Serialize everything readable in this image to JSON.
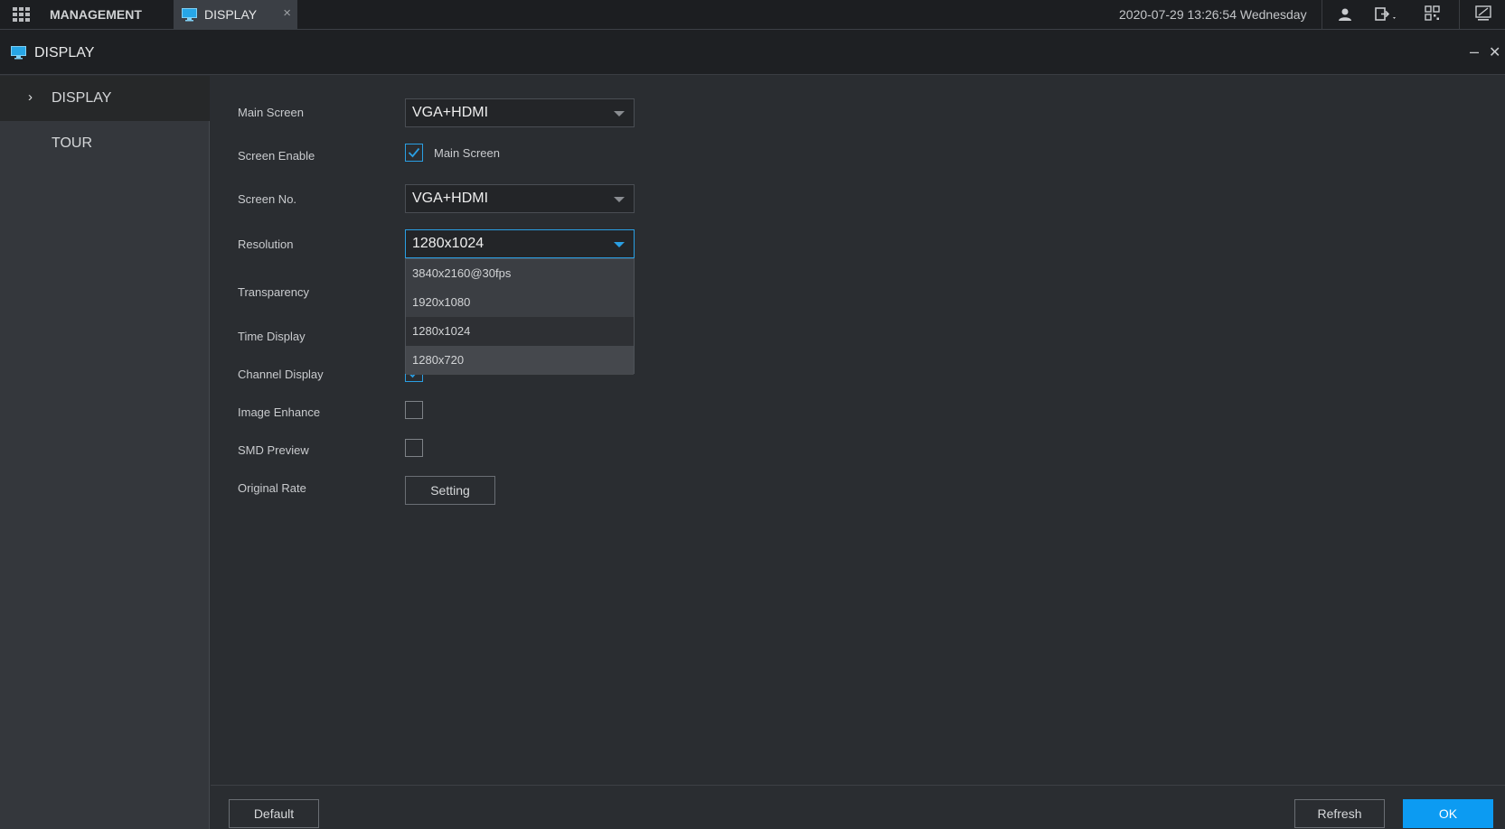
{
  "topbar": {
    "management_label": "MANAGEMENT",
    "tab_label": "DISPLAY",
    "tab_close": "×",
    "datetime": "2020-07-29 13:26:54 Wednesday"
  },
  "titlebar": {
    "title": "DISPLAY",
    "minimize": "–",
    "close": "✕"
  },
  "sidebar": {
    "items": [
      {
        "label": "DISPLAY",
        "active": true
      },
      {
        "label": "TOUR",
        "active": false
      }
    ]
  },
  "form": {
    "main_screen": {
      "label": "Main Screen",
      "value": "VGA+HDMI"
    },
    "screen_enable": {
      "label": "Screen Enable",
      "checkbox_label": "Main Screen",
      "checked": true
    },
    "screen_no": {
      "label": "Screen No.",
      "value": "VGA+HDMI"
    },
    "resolution": {
      "label": "Resolution",
      "value": "1280x1024",
      "options": [
        "3840x2160@30fps",
        "1920x1080",
        "1280x1024",
        "1280x720"
      ]
    },
    "transparency": {
      "label": "Transparency"
    },
    "time_display": {
      "label": "Time Display"
    },
    "channel_display": {
      "label": "Channel Display",
      "checked": true
    },
    "image_enhance": {
      "label": "Image Enhance",
      "checked": false
    },
    "smd_preview": {
      "label": "SMD Preview",
      "checked": false
    },
    "original_rate": {
      "label": "Original Rate",
      "button": "Setting"
    }
  },
  "footer": {
    "default_label": "Default",
    "refresh_label": "Refresh",
    "ok_label": "OK"
  },
  "colors": {
    "accent": "#0c9bf2",
    "checkbox_accent": "#2a9fe3",
    "background": "#2a2d31",
    "sidebar": "#34373c"
  }
}
